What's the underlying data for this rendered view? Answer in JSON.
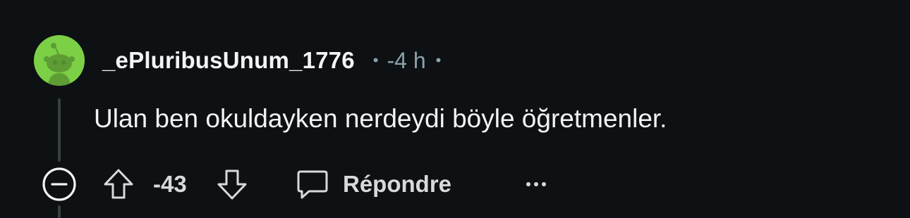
{
  "comment": {
    "username": "_ePluribusUnum_1776",
    "separator": "•",
    "time": "-4 h",
    "text": "Ulan ben okuldayken nerdeydi böyle öğretmenler.",
    "avatar_icon": "snoo-avatar-icon",
    "avatar_color": "#7bd046"
  },
  "actions": {
    "collapse_icon": "minus-circle-icon",
    "upvote_icon": "arrow-up-icon",
    "score": "-43",
    "downvote_icon": "arrow-down-icon",
    "reply_icon": "speech-bubble-icon",
    "reply_label": "Répondre",
    "more_icon": "ellipsis-icon"
  },
  "colors": {
    "background": "#0e1113",
    "text_primary": "#f2f4f5",
    "text_secondary": "#8ba2ad",
    "thread_line": "#3a3f42"
  }
}
